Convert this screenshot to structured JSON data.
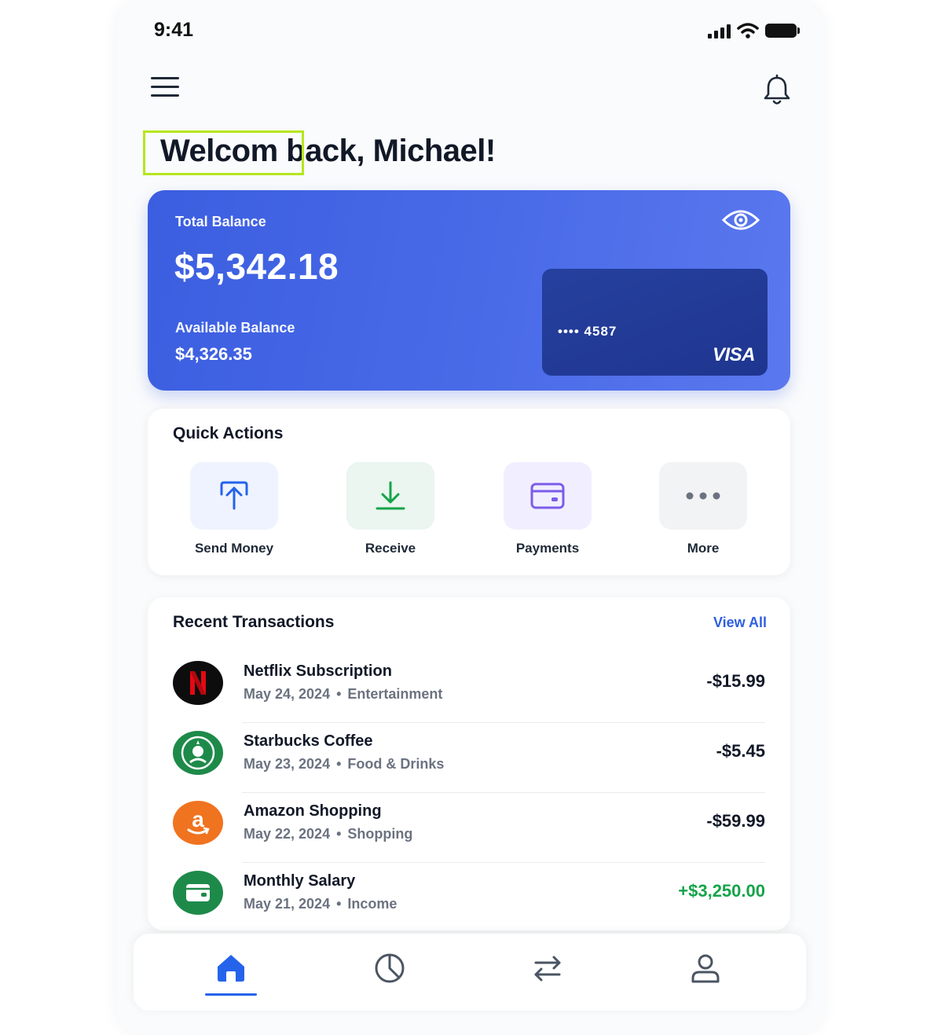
{
  "status_bar": {
    "time": "9:41"
  },
  "header": {
    "menu_icon": "hamburger-menu-icon",
    "notification_icon": "bell-icon"
  },
  "greeting": {
    "text": "Welcom back, Michael!"
  },
  "balance": {
    "total_label": "Total Balance",
    "total_amount": "$5,342.18",
    "available_label": "Available Balance",
    "available_amount": "$4,326.35",
    "visibility_icon": "eye-icon",
    "card": {
      "number": "•••• 4587",
      "brand": "VISA"
    }
  },
  "quick_actions": {
    "title": "Quick Actions",
    "items": [
      {
        "label": "Send Money",
        "icon": "send-up-arrow-icon",
        "tile_color": "#eef3ff",
        "icon_color": "#2563eb"
      },
      {
        "label": "Receive",
        "icon": "download-icon",
        "tile_color": "#eaf6ef",
        "icon_color": "#16a34a"
      },
      {
        "label": "Payments",
        "icon": "card-wallet-icon",
        "tile_color": "#f1efff",
        "icon_color": "#7c5ce8"
      },
      {
        "label": "More",
        "icon": "more-dots-icon",
        "tile_color": "#f2f3f5",
        "icon_color": "#6b7280"
      }
    ]
  },
  "transactions": {
    "title": "Recent Transactions",
    "view_all_label": "View All",
    "items": [
      {
        "name": "Netflix Subscription",
        "date": "May 24, 2024",
        "category": "Entertainment",
        "amount": "-$15.99",
        "logo": "netflix-logo-icon",
        "logo_color": "#0d0d0d"
      },
      {
        "name": "Starbucks Coffee",
        "date": "May 23, 2024",
        "category": "Food & Drinks",
        "amount": "-$5.45",
        "logo": "starbucks-logo-icon",
        "logo_color": "#1e8a4a"
      },
      {
        "name": "Amazon Shopping",
        "date": "May 22, 2024",
        "category": "Shopping",
        "amount": "-$59.99",
        "logo": "amazon-logo-icon",
        "logo_color": "#f0731f"
      },
      {
        "name": "Monthly Salary",
        "date": "May 21, 2024",
        "category": "Income",
        "amount": "+$3,250.00",
        "logo": "wallet-icon",
        "logo_color": "#1e8a4a"
      }
    ]
  },
  "bottom_nav": {
    "items": [
      {
        "icon": "home-icon",
        "active": true
      },
      {
        "icon": "pie-chart-icon",
        "active": false
      },
      {
        "icon": "transfer-arrows-icon",
        "active": false
      },
      {
        "icon": "profile-icon",
        "active": false
      }
    ],
    "active_color": "#2563eb"
  },
  "colors": {
    "accent": "#2f5fe0",
    "card_gradient_start": "#3b5ee0",
    "card_gradient_end": "#5a78ee",
    "positive": "#16a34a",
    "highlight_box": "#b5e61d"
  }
}
